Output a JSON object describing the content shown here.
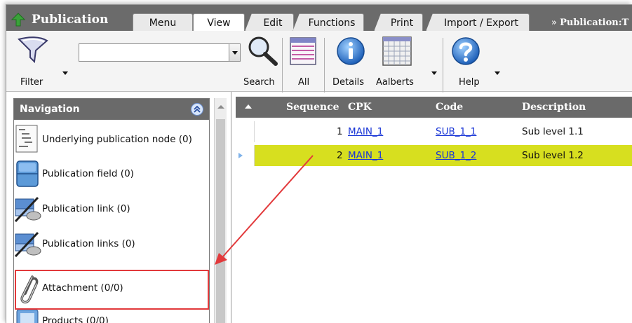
{
  "tabbar": {
    "app_title": "Publication",
    "tabs": [
      {
        "label": "Menu"
      },
      {
        "label": "View"
      },
      {
        "label": "Edit"
      },
      {
        "label": "Functions"
      },
      {
        "label": "Print"
      },
      {
        "label": "Import / Export"
      }
    ],
    "active_tab": "View",
    "breadcrumb_prefix": "» ",
    "breadcrumb_label": "Publication:T"
  },
  "toolbar": {
    "filter_label": "Filter",
    "search_value": "",
    "search_label": "Search",
    "all_label": "All",
    "details_label": "Details",
    "aalberts_label": "Aalberts",
    "help_label": "Help"
  },
  "navigation": {
    "title": "Navigation",
    "items": [
      {
        "label": "Underlying publication node (0)",
        "icon": "tree-node-icon"
      },
      {
        "label": "Publication field (0)",
        "icon": "field-icon"
      },
      {
        "label": "Publication link (0)",
        "icon": "link-icon"
      },
      {
        "label": "Publication links (0)",
        "icon": "links-icon"
      },
      {
        "label": "Attachment (0/0)",
        "icon": "paperclip-icon"
      },
      {
        "label": "Products (0/0)",
        "icon": "products-icon"
      }
    ]
  },
  "grid": {
    "columns": [
      "Sequence",
      "CPK",
      "Code",
      "Description"
    ],
    "rows": [
      {
        "sequence": "1",
        "cpk": "MAIN_1",
        "code": "SUB_1_1",
        "description": "Sub level 1.1",
        "selected": false
      },
      {
        "sequence": "2",
        "cpk": "MAIN_1",
        "code": "SUB_1_2",
        "description": "Sub level 1.2",
        "selected": true
      }
    ]
  },
  "colors": {
    "header_gray": "#6a6a6a",
    "selected_row": "#d7df1f",
    "link": "#1a36d6",
    "annotation_red": "#e2393b",
    "logo_green": "#3aa23a"
  }
}
